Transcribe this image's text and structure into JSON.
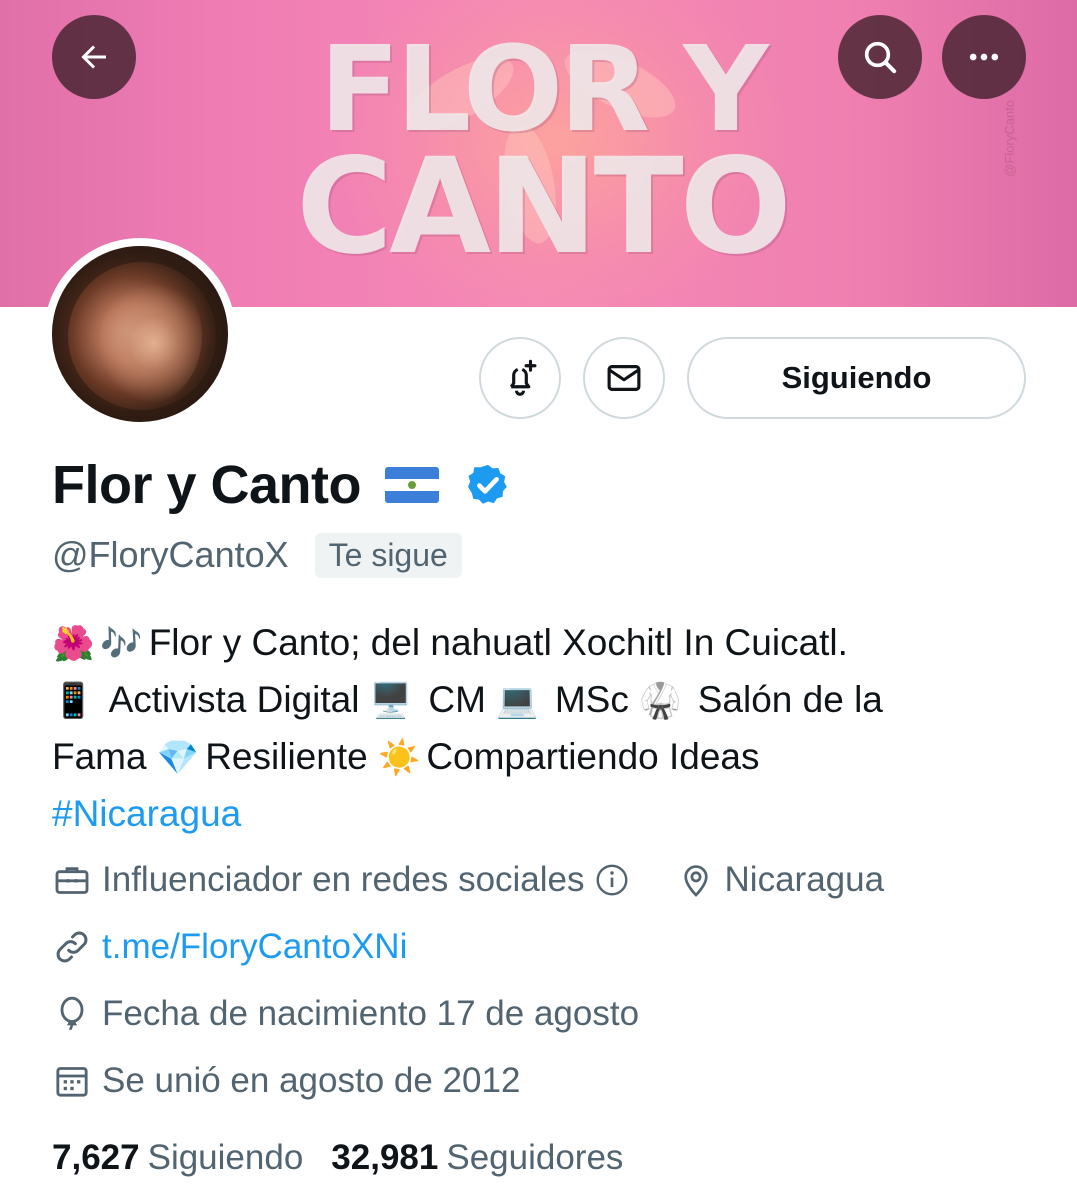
{
  "header": {
    "banner_text_line1": "FLOR Y",
    "banner_text_line2": "CANTO",
    "banner_watermark": "@FloryCanto"
  },
  "nav": {
    "back_icon": "arrow-left-icon",
    "search_icon": "search-icon",
    "more_icon": "more-horizontal-icon"
  },
  "profile": {
    "display_name": "Flor y Canto",
    "handle": "@FloryCantoX",
    "follows_you": "Te sigue",
    "follow_button": "Siguiendo",
    "flag_emoji": "🇳🇮",
    "verified": true
  },
  "bio": {
    "line1_emoji_a": "🌺",
    "line1_emoji_b": "🎶",
    "line1_text": "Flor y Canto; del nahuatl Xochitl In Cuicatl.",
    "e_phone": "📱",
    "t_activista": "Activista Digital",
    "e_desktop": "🖥️",
    "t_cm": "CM",
    "e_laptop": "💻",
    "t_msc": "MSc",
    "e_gi": "🥋",
    "t_salon": "Salón de la",
    "t_fama": "Fama",
    "e_gem": "💎",
    "t_resiliente": "Resiliente",
    "e_sun": "☀️",
    "t_compartiendo": "Compartiendo Ideas",
    "hashtag": "#Nicaragua"
  },
  "meta": {
    "category": "Influenciador en redes sociales",
    "location": "Nicaragua",
    "url": "t.me/FloryCantoXNi",
    "birthday": "Fecha de nacimiento 17 de agosto",
    "joined": "Se unió en agosto de 2012"
  },
  "stats": {
    "following_count": "7,627",
    "following_label": "Siguiendo",
    "followers_count": "32,981",
    "followers_label": "Seguidores"
  },
  "colors": {
    "link": "#1d9bf0",
    "secondary_text": "#536471",
    "primary_text": "#0f1419",
    "border": "#cfd9de",
    "banner_pink": "#f07cb4"
  }
}
